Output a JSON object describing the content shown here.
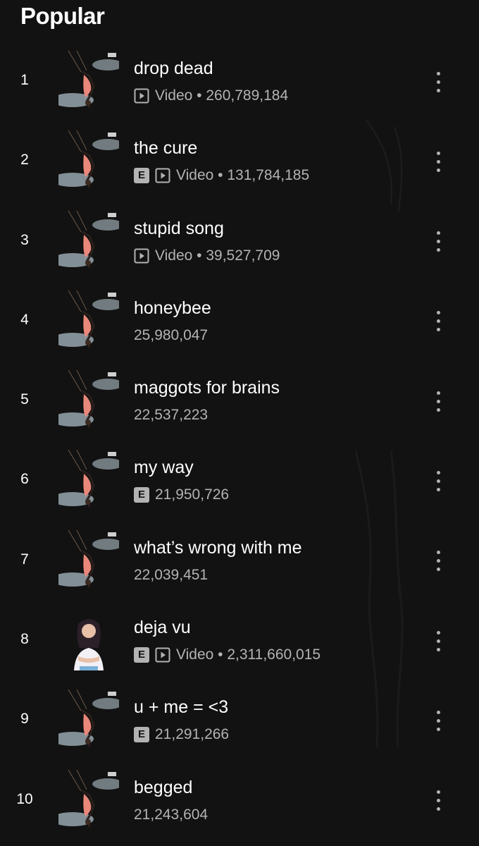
{
  "section": {
    "title": "Popular"
  },
  "tracks": [
    {
      "number": "1",
      "title": "drop dead",
      "explicit": false,
      "video": true,
      "meta": "Video • 260,789,184",
      "cover": "guts-spilled-swing"
    },
    {
      "number": "2",
      "title": "the cure",
      "explicit": true,
      "video": true,
      "meta": "Video • 131,784,185",
      "cover": "guts-spilled-swing"
    },
    {
      "number": "3",
      "title": "stupid song",
      "explicit": false,
      "video": true,
      "meta": "Video • 39,527,709",
      "cover": "guts-spilled-swing"
    },
    {
      "number": "4",
      "title": "honeybee",
      "explicit": false,
      "video": false,
      "meta": "25,980,047",
      "cover": "guts-spilled-swing"
    },
    {
      "number": "5",
      "title": "maggots for brains",
      "explicit": false,
      "video": false,
      "meta": "22,537,223",
      "cover": "guts-spilled-swing"
    },
    {
      "number": "6",
      "title": "my way",
      "explicit": true,
      "video": false,
      "meta": "21,950,726",
      "cover": "guts-spilled-swing"
    },
    {
      "number": "7",
      "title": "what’s wrong with me",
      "explicit": false,
      "video": false,
      "meta": "22,039,451",
      "cover": "guts-spilled-swing"
    },
    {
      "number": "8",
      "title": "deja vu",
      "explicit": true,
      "video": true,
      "meta": "Video • 2,311,660,015",
      "cover": "sour-purple"
    },
    {
      "number": "9",
      "title": "u + me = <3",
      "explicit": true,
      "video": false,
      "meta": "21,291,266",
      "cover": "guts-spilled-swing"
    },
    {
      "number": "10",
      "title": "begged",
      "explicit": false,
      "video": false,
      "meta": "21,243,604",
      "cover": "guts-spilled-swing"
    }
  ],
  "labels": {
    "explicit": "E"
  },
  "colors": {
    "background": "#121212",
    "primary_text": "#ffffff",
    "secondary_text": "#b3b3b3",
    "sky_cover": "#9cc6dd",
    "purple_cover": "#8a7fd6"
  },
  "icons": {
    "video": "video-play-icon",
    "more": "more-vertical-icon",
    "explicit": "explicit-badge-icon"
  }
}
